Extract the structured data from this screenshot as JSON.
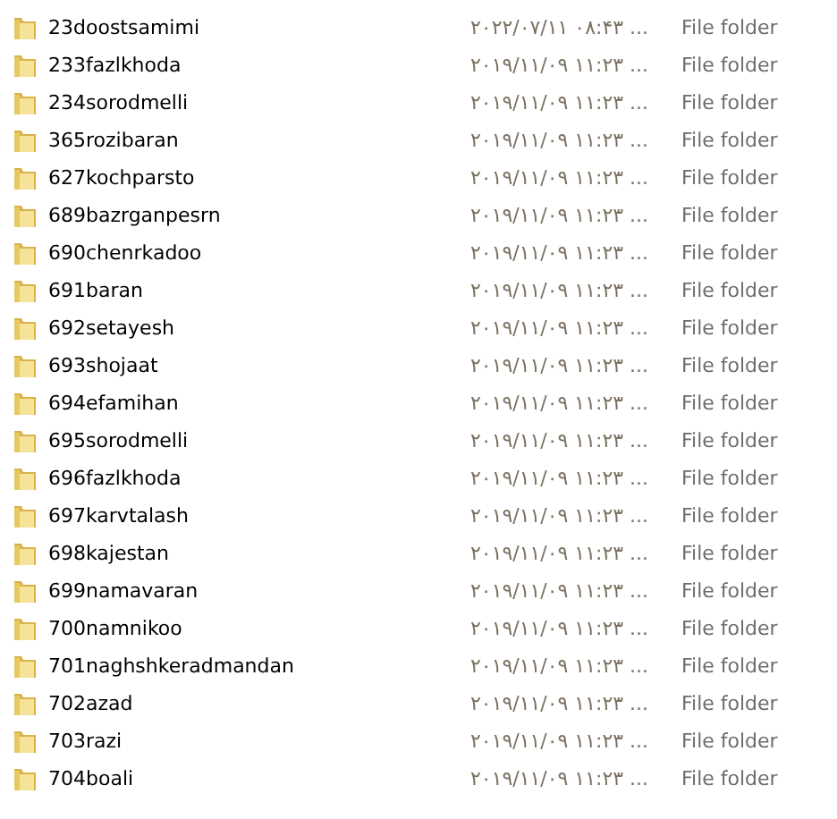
{
  "rows": [
    {
      "name": "23doostsamimi",
      "date": "۲۰۲۲/۰۷/۱۱ ۰۸:۴۳ ...",
      "type": "File folder"
    },
    {
      "name": "233fazlkhoda",
      "date": "۲۰۱۹/۱۱/۰۹ ۱۱:۲۳ ...",
      "type": "File folder"
    },
    {
      "name": "234sorodmelli",
      "date": "۲۰۱۹/۱۱/۰۹ ۱۱:۲۳ ...",
      "type": "File folder"
    },
    {
      "name": "365rozibaran",
      "date": "۲۰۱۹/۱۱/۰۹ ۱۱:۲۳ ...",
      "type": "File folder"
    },
    {
      "name": "627kochparsto",
      "date": "۲۰۱۹/۱۱/۰۹ ۱۱:۲۳ ...",
      "type": "File folder"
    },
    {
      "name": "689bazrganpesrn",
      "date": "۲۰۱۹/۱۱/۰۹ ۱۱:۲۳ ...",
      "type": "File folder"
    },
    {
      "name": "690chenrkadoo",
      "date": "۲۰۱۹/۱۱/۰۹ ۱۱:۲۳ ...",
      "type": "File folder"
    },
    {
      "name": "691baran",
      "date": "۲۰۱۹/۱۱/۰۹ ۱۱:۲۳ ...",
      "type": "File folder"
    },
    {
      "name": "692setayesh",
      "date": "۲۰۱۹/۱۱/۰۹ ۱۱:۲۳ ...",
      "type": "File folder"
    },
    {
      "name": "693shojaat",
      "date": "۲۰۱۹/۱۱/۰۹ ۱۱:۲۳ ...",
      "type": "File folder"
    },
    {
      "name": "694efamihan",
      "date": "۲۰۱۹/۱۱/۰۹ ۱۱:۲۳ ...",
      "type": "File folder"
    },
    {
      "name": "695sorodmelli",
      "date": "۲۰۱۹/۱۱/۰۹ ۱۱:۲۳ ...",
      "type": "File folder"
    },
    {
      "name": "696fazlkhoda",
      "date": "۲۰۱۹/۱۱/۰۹ ۱۱:۲۳ ...",
      "type": "File folder"
    },
    {
      "name": "697karvtalash",
      "date": "۲۰۱۹/۱۱/۰۹ ۱۱:۲۳ ...",
      "type": "File folder"
    },
    {
      "name": "698kajestan",
      "date": "۲۰۱۹/۱۱/۰۹ ۱۱:۲۳ ...",
      "type": "File folder"
    },
    {
      "name": "699namavaran",
      "date": "۲۰۱۹/۱۱/۰۹ ۱۱:۲۳ ...",
      "type": "File folder"
    },
    {
      "name": "700namnikoo",
      "date": "۲۰۱۹/۱۱/۰۹ ۱۱:۲۳ ...",
      "type": "File folder"
    },
    {
      "name": "701naghshkeradmandan",
      "date": "۲۰۱۹/۱۱/۰۹ ۱۱:۲۳ ...",
      "type": "File folder"
    },
    {
      "name": "702azad",
      "date": "۲۰۱۹/۱۱/۰۹ ۱۱:۲۳ ...",
      "type": "File folder"
    },
    {
      "name": "703razi",
      "date": "۲۰۱۹/۱۱/۰۹ ۱۱:۲۳ ...",
      "type": "File folder"
    },
    {
      "name": "704boali",
      "date": "۲۰۱۹/۱۱/۰۹ ۱۱:۲۳ ...",
      "type": "File folder"
    }
  ]
}
